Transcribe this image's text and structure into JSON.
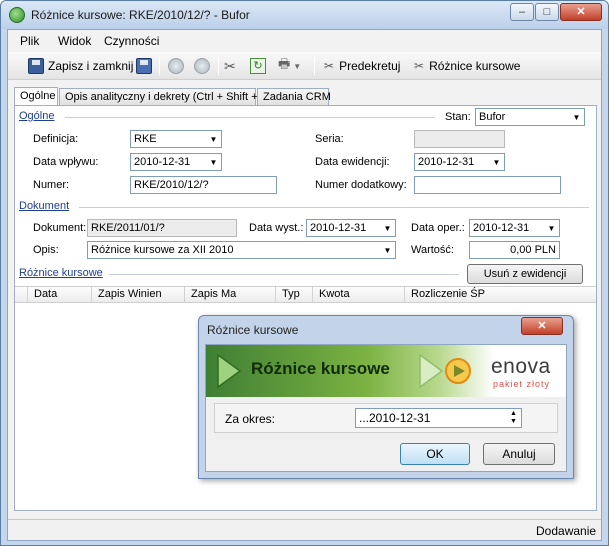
{
  "window": {
    "title": "Różnice kursowe: RKE/2010/12/? - Bufor",
    "controls": {
      "minimize": "–",
      "maximize": "□",
      "close": "✕"
    }
  },
  "menu": {
    "items": [
      "Plik",
      "Widok",
      "Czynności"
    ]
  },
  "toolbar": {
    "save_close": "Zapisz i zamknij",
    "predekretuj": "Predekretuj",
    "roznice": "Różnice kursowe"
  },
  "tabs": [
    "Ogólne",
    "Opis analityczny i dekrety (Ctrl + Shift + D)",
    "Zadania CRM"
  ],
  "ogolne": {
    "section": "Ogólne",
    "stan_label": "Stan:",
    "stan_value": "Bufor",
    "definicja_label": "Definicja:",
    "definicja_value": "RKE",
    "seria_label": "Seria:",
    "seria_value": "",
    "data_wplywu_label": "Data wpływu:",
    "data_wplywu_value": "2010-12-31",
    "data_ewidencji_label": "Data ewidencji:",
    "data_ewidencji_value": "2010-12-31",
    "numer_label": "Numer:",
    "numer_value": "RKE/2010/12/?",
    "numer_dod_label": "Numer dodatkowy:",
    "numer_dod_value": ""
  },
  "dokument": {
    "section": "Dokument",
    "dokument_label": "Dokument:",
    "dokument_value": "RKE/2011/01/?",
    "data_wyst_label": "Data wyst.:",
    "data_wyst_value": "2010-12-31",
    "data_oper_label": "Data oper.:",
    "data_oper_value": "2010-12-31",
    "opis_label": "Opis:",
    "opis_value": "Różnice kursowe za XII 2010",
    "wartosc_label": "Wartość:",
    "wartosc_value": "0,00 PLN"
  },
  "roznice": {
    "section": "Różnice kursowe",
    "remove_button": "Usuń z ewidencji",
    "columns": [
      "Data",
      "Zapis Winien",
      "Zapis Ma",
      "Typ",
      "Kwota",
      "Rozliczenie ŚP"
    ]
  },
  "status": {
    "text": "Dodawanie"
  },
  "dialog": {
    "title": "Różnice kursowe",
    "banner_title": "Różnice kursowe",
    "logo": "enova",
    "logo_sub": "pakiet złoty",
    "za_okres_label": "Za okres:",
    "za_okres_value": "...2010-12-31",
    "ok": "OK",
    "cancel": "Anuluj"
  }
}
